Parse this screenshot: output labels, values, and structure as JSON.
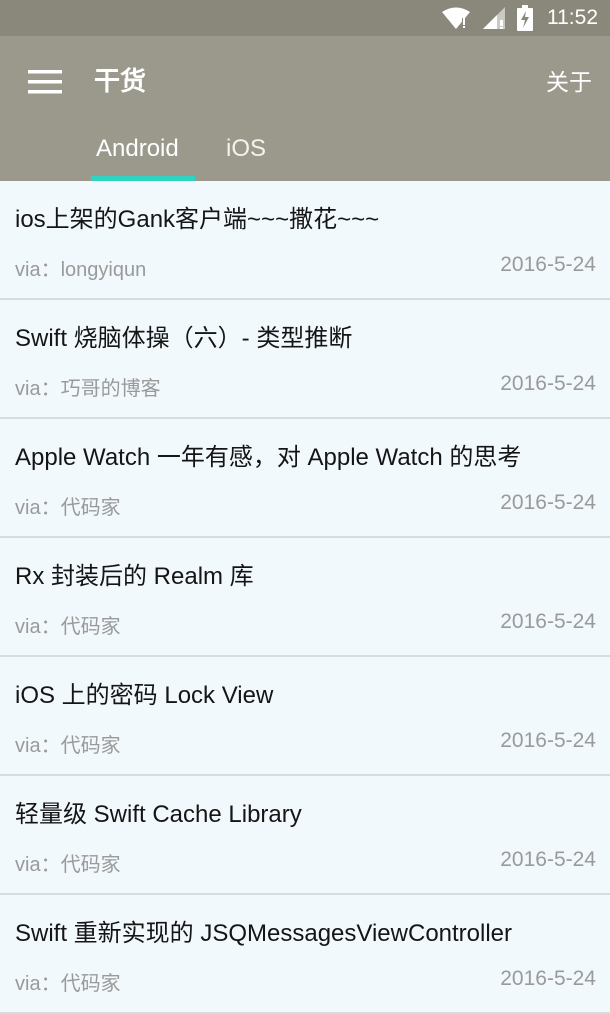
{
  "status_bar": {
    "time": "11:52",
    "icons": [
      "wifi-icon",
      "signal-icon",
      "battery-charging-icon"
    ]
  },
  "app_bar": {
    "title": "干货",
    "about_label": "关于",
    "menu_icon": "hamburger-menu-icon"
  },
  "tabs": [
    {
      "label": "Android",
      "selected": true
    },
    {
      "label": "iOS",
      "selected": false
    }
  ],
  "colors": {
    "status_bar": "#8a877b",
    "app_bar": "#9b998b",
    "tab_indicator": "#2fd3c0",
    "list_background": "#f2f9fd"
  },
  "items": [
    {
      "title": "ios上架的Gank客户端~~~撒花~~~",
      "via": "via：longyiqun",
      "date": "2016-5-24"
    },
    {
      "title": "Swift 烧脑体操（六）- 类型推断",
      "via": "via：巧哥的博客",
      "date": "2016-5-24"
    },
    {
      "title": "Apple Watch 一年有感，对 Apple Watch 的思考",
      "via": "via：代码家",
      "date": "2016-5-24"
    },
    {
      "title": "Rx 封装后的 Realm 库",
      "via": "via：代码家",
      "date": "2016-5-24"
    },
    {
      "title": "iOS 上的密码 Lock View",
      "via": "via：代码家",
      "date": "2016-5-24"
    },
    {
      "title": "轻量级 Swift Cache Library",
      "via": "via：代码家",
      "date": "2016-5-24"
    },
    {
      "title": "Swift 重新实现的 JSQMessagesViewController",
      "via": "via：代码家",
      "date": "2016-5-24"
    }
  ]
}
